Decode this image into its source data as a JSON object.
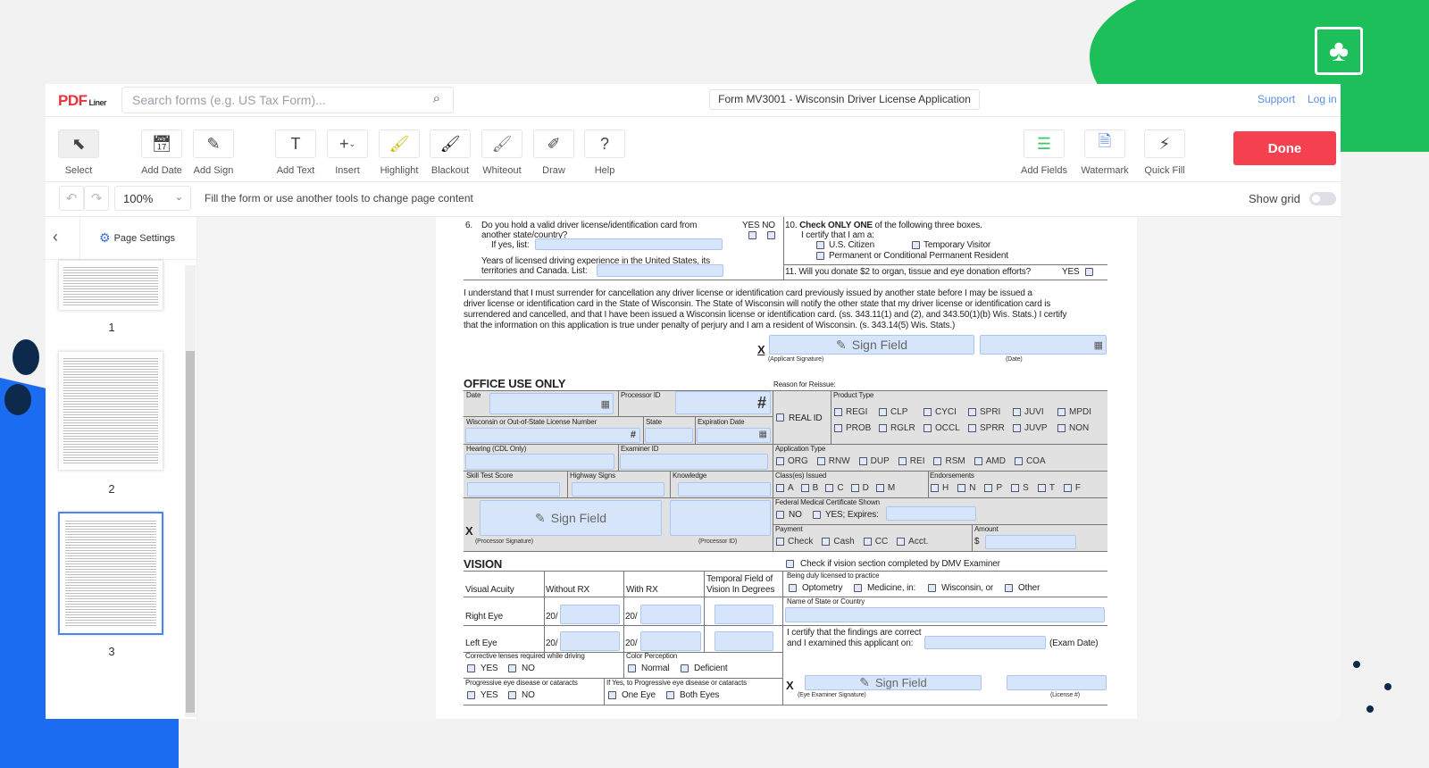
{
  "header": {
    "logo": "PDFLiner",
    "logo_main": "PDF",
    "logo_sub": "Liner",
    "search_placeholder": "Search forms (e.g. US Tax Form)...",
    "doc_title": "Form MV3001 - Wisconsin Driver License Application",
    "support": "Support",
    "login": "Log in"
  },
  "toolbar": {
    "tools": [
      {
        "label": "Select",
        "icon": "select-icon"
      },
      {
        "label": "Add Date",
        "icon": "calendar-icon"
      },
      {
        "label": "Add Sign",
        "icon": "pen-icon"
      },
      {
        "label": "Add Text",
        "icon": "text-icon"
      },
      {
        "label": "Insert",
        "icon": "plus-icon"
      },
      {
        "label": "Highlight",
        "icon": "highlighter-icon"
      },
      {
        "label": "Blackout",
        "icon": "blackout-brush-icon"
      },
      {
        "label": "Whiteout",
        "icon": "whiteout-brush-icon"
      },
      {
        "label": "Draw",
        "icon": "brush-icon"
      },
      {
        "label": "Help",
        "icon": "question-icon"
      }
    ],
    "right_tools": [
      {
        "label": "Add Fields",
        "icon": "fields-icon"
      },
      {
        "label": "Watermark",
        "icon": "watermark-icon"
      },
      {
        "label": "Quick Fill",
        "icon": "lightning-icon"
      }
    ],
    "done": "Done",
    "done_color": "#f5414f"
  },
  "subbar": {
    "zoom": "100%",
    "hint": "Fill the form or use another tools to change page content",
    "show_grid": "Show grid",
    "show_grid_on": false
  },
  "sidebar": {
    "page_settings": "Page Settings",
    "pages": [
      "1",
      "2",
      "3"
    ],
    "selected_page": "3"
  },
  "form": {
    "q6": {
      "num": "6.",
      "line1": "Do you hold a valid driver license/identification card from",
      "line2": "another state/country?",
      "if_yes": "If yes, list:",
      "years1": "Years of licensed driving experience in the United States, its",
      "years2": "territories and Canada. List:",
      "yes_no": "YES NO"
    },
    "q10": {
      "num": "10.",
      "bold": "Check ONLY ONE",
      "rest": " of the following three boxes.",
      "certify": "I certify that I am a:",
      "opt1": "U.S. Citizen",
      "opt2": "Temporary Visitor",
      "opt3": "Permanent or Conditional Permanent Resident"
    },
    "q11": {
      "text": "11. Will you donate $2 to organ, tissue and eye donation efforts?",
      "yes": "YES"
    },
    "statement": [
      "I understand that I must surrender for cancellation any driver license or identification card previously issued by another state before I may be issued a",
      "driver license or identification card in the State of Wisconsin. The State of Wisconsin will notify the other state that my driver license or identification card is",
      "surrendered and cancelled, and that I have been issued a Wisconsin license or identification card. (ss. 343.11(1) and (2), and 343.50(1)(b) Wis. Stats.) I certify",
      "that the information on this application is true under penalty of perjury and I am a resident of Wisconsin. (s. 343.14(5) Wis. Stats.)"
    ],
    "x": "X",
    "sign_field": "Sign Field",
    "applicant_signature": "(Applicant Signature)",
    "date_label": "(Date)",
    "office": {
      "title": "OFFICE USE ONLY",
      "reason": "Reason for Reissue:",
      "date": "Date",
      "processor_id": "Processor ID",
      "license_number": "Wisconsin or Out-of-State License Number",
      "state": "State",
      "expiration": "Expiration Date",
      "hearing": "Hearing (CDL Only)",
      "examiner_id": "Examiner ID",
      "skill": "Skill Test Score",
      "highway": "Highway Signs",
      "knowledge": "Knowledge",
      "processor_signature": "(Processor Signature)",
      "processor_id_label": "(Processor ID)",
      "hash": "#",
      "real_id": "REAL ID",
      "product_type": "Product Type",
      "products": [
        "REGI",
        "CLP",
        "CYCI",
        "SPRI",
        "JUVI",
        "MPDI",
        "PROB",
        "RGLR",
        "OCCL",
        "SPRR",
        "JUVP",
        "NON"
      ],
      "app_type": "Application Type",
      "app_types": [
        "ORG",
        "RNW",
        "DUP",
        "REI",
        "RSM",
        "AMD",
        "COA"
      ],
      "classes": "Class(es) Issued",
      "class_list": [
        "A",
        "B",
        "C",
        "D",
        "M"
      ],
      "endorsements": "Endorsements",
      "endorse_list": [
        "H",
        "N",
        "P",
        "S",
        "T",
        "F"
      ],
      "medical": "Federal Medical Certificate Shown",
      "med_no": "NO",
      "med_yes": "YES; Expires:",
      "payment": "Payment",
      "payments": [
        "Check",
        "Cash",
        "CC",
        "Acct."
      ],
      "amount": "Amount",
      "dollar": "$"
    },
    "vision": {
      "title": "VISION",
      "dmv_check": "Check if vision section completed by DMV Examiner",
      "acuity": "Visual Acuity",
      "without_rx": "Without RX",
      "with_rx": "With RX",
      "temporal1": "Temporal Field of",
      "temporal2": "Vision In Degrees",
      "right_eye": "Right Eye",
      "left_eye": "Left Eye",
      "twenty": "20/",
      "corrective": "Corrective lenses required while driving",
      "yes": "YES",
      "no": "NO",
      "color": "Color Perception",
      "normal": "Normal",
      "deficient": "Deficient",
      "progressive": "Progressive eye disease or cataracts",
      "if_yes_prog": "If Yes, to Progressive eye disease or cataracts",
      "one_eye": "One Eye",
      "both_eyes": "Both Eyes",
      "licensed": "Being duly licensed to practice",
      "practices": [
        "Optometry",
        "Medicine, in:",
        "Wisconsin, or",
        "Other"
      ],
      "state_country": "Name of State or Country",
      "certify1": "I certify that the findings are correct",
      "certify2": "and I examined this applicant on:",
      "exam_date": "(Exam Date)",
      "examiner_signature": "(Eye Examiner Signature)",
      "license_no": "(License #)"
    }
  }
}
